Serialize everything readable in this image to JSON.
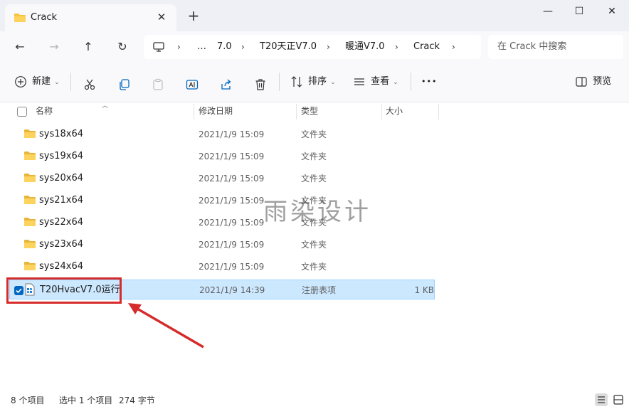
{
  "window": {
    "tab_title": "Crack",
    "close_tab": "✕",
    "new_tab": "+",
    "minimize": "—",
    "maximize": "☐",
    "close": "✕"
  },
  "nav": {
    "back": "←",
    "forward": "→",
    "up": "↑",
    "refresh": "↻",
    "breadcrumb": [
      {
        "label": "…"
      },
      {
        "label": "7.0"
      },
      {
        "label": "T20天正V7.0"
      },
      {
        "label": "暖通V7.0"
      },
      {
        "label": "Crack"
      }
    ],
    "separator": "›",
    "search_placeholder": "在 Crack 中搜索"
  },
  "toolbar": {
    "new_label": "新建",
    "sort_label": "排序",
    "view_label": "查看",
    "more_label": "•••",
    "preview_label": "预览"
  },
  "columns": {
    "name": "名称",
    "modified": "修改日期",
    "type": "类型",
    "size": "大小"
  },
  "files": [
    {
      "name": "sys18x64",
      "date": "2021/1/9 15:09",
      "type": "文件夹",
      "size": ""
    },
    {
      "name": "sys19x64",
      "date": "2021/1/9 15:09",
      "type": "文件夹",
      "size": ""
    },
    {
      "name": "sys20x64",
      "date": "2021/1/9 15:09",
      "type": "文件夹",
      "size": ""
    },
    {
      "name": "sys21x64",
      "date": "2021/1/9 15:09",
      "type": "文件夹",
      "size": ""
    },
    {
      "name": "sys22x64",
      "date": "2021/1/9 15:09",
      "type": "文件夹",
      "size": ""
    },
    {
      "name": "sys23x64",
      "date": "2021/1/9 15:09",
      "type": "文件夹",
      "size": ""
    },
    {
      "name": "sys24x64",
      "date": "2021/1/9 15:09",
      "type": "文件夹",
      "size": ""
    },
    {
      "name": "T20HvacV7.0运行",
      "date": "2021/1/9 14:39",
      "type": "注册表项",
      "size": "1 KB",
      "selected": true
    }
  ],
  "watermark": "雨染设计",
  "status": {
    "item_count": "8 个项目",
    "selection": "选中 1 个项目",
    "selection_size": "274 字节"
  },
  "colors": {
    "accent": "#0067c0",
    "selection_bg": "#cce8ff",
    "annotation_red": "#d62b2b",
    "folder_yellow": "#f5c542"
  }
}
